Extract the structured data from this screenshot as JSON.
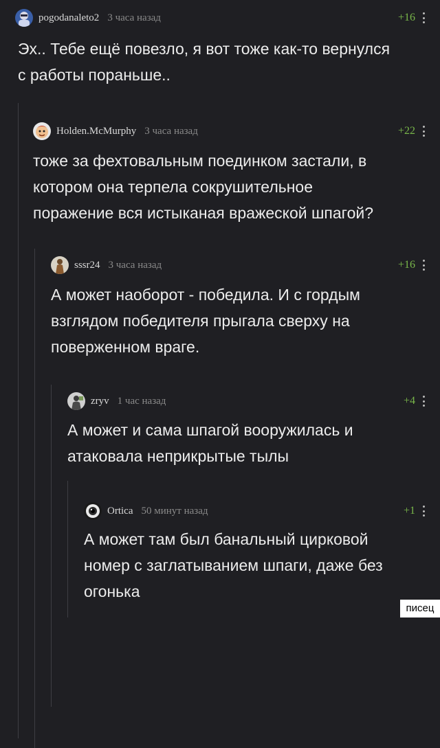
{
  "comments": [
    {
      "username": "pogodanaleto2",
      "time": "3 часа назад",
      "rating": "+16",
      "avatar_icon": "person-avatar-icon",
      "lines": [
        "Эх.. Тебе ещё повезло, я вот тоже как-то вернулся",
        "с работы пораньше.."
      ]
    },
    {
      "username": "Holden.McMurphy",
      "time": "3 часа назад",
      "rating": "+22",
      "avatar_icon": "cartoon-face-avatar-icon",
      "lines": [
        "тоже за фехтовальным поединком застали, в",
        "котором она терпела сокрушительное",
        "поражение вся истыканая вражеской шпагой?"
      ]
    },
    {
      "username": "sssr24",
      "time": "3 часа назад",
      "rating": "+16",
      "avatar_icon": "figure-avatar-icon",
      "lines": [
        "А может наоборот - победила.  И с гордым",
        "взглядом победителя прыгала сверху на",
        "поверженном враге."
      ]
    },
    {
      "username": "zryv",
      "time": "1 час назад",
      "rating": "+4",
      "avatar_icon": "figure-avatar-icon",
      "lines": [
        "А может и сама шпагой вооружилась и",
        "атаковала неприкрытые тылы"
      ]
    },
    {
      "username": "Ortica",
      "time": "50 минут назад",
      "rating": "+1",
      "avatar_icon": "eye-avatar-icon",
      "lines": [
        "А может там был банальный цирковой",
        "номер с заглатыванием шпаги, даже без",
        "огонька"
      ]
    }
  ],
  "watermark": "писец",
  "colors": {
    "background": "#1f1f23",
    "rating": "#79b74a",
    "thread_line": "#3e3e44"
  }
}
